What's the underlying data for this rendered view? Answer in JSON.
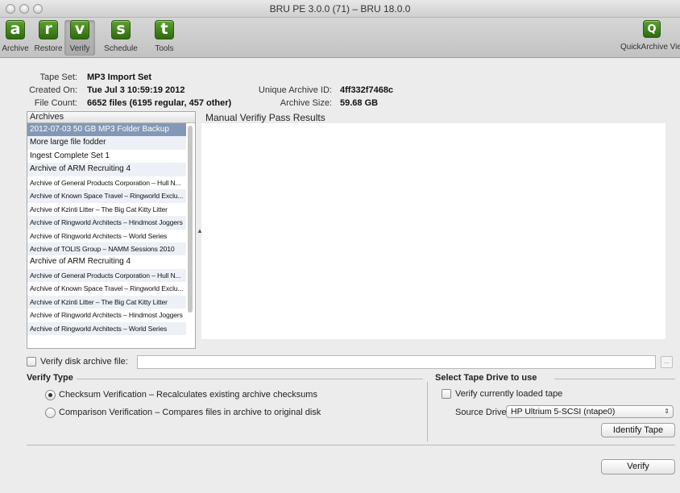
{
  "window": {
    "title": "BRU PE 3.0.0 (71) – BRU 18.0.0"
  },
  "toolbar": {
    "buttons": [
      {
        "glyph": "a",
        "label": "Archive",
        "icon": "archive-icon"
      },
      {
        "glyph": "r",
        "label": "Restore",
        "icon": "restore-icon"
      },
      {
        "glyph": "v",
        "label": "Verify",
        "icon": "verify-icon",
        "selected": true
      },
      {
        "glyph": "s",
        "label": "Schedule",
        "icon": "schedule-icon"
      },
      {
        "glyph": "t",
        "label": "Tools",
        "icon": "tools-icon"
      }
    ],
    "quickview": {
      "glyph": "Q",
      "label": "QuickArchive View",
      "icon": "quickarchive-view-icon"
    }
  },
  "info": {
    "tape_set_label": "Tape Set:",
    "tape_set": "MP3 Import Set",
    "created_on_label": "Created On:",
    "created_on": "Tue Jul  3 10:59:19 2012",
    "file_count_label": "File Count:",
    "file_count": "6652 files (6195 regular, 457 other)",
    "unique_id_label": "Unique Archive ID:",
    "unique_id": "4ff332f7468c",
    "archive_size_label": "Archive Size:",
    "archive_size": "59.68 GB"
  },
  "archives": {
    "header": "Archives",
    "items": [
      "2012-07-03 50 GB MP3 Folder Backup",
      "More large file fodder",
      "Ingest Complete Set 1",
      "Archive of ARM Recruiting 4",
      "Archive of General Products Corporation – Hull N...",
      "Archive of Known Space Travel – Ringworld Exclu...",
      "Archive of Kzinti Litter – The Big Cat Kitty Litter",
      "Archive of Ringworld Architects – Hindmost Joggers",
      "Archive of Ringworld Architects – World Series",
      "Archive of TOLIS Group – NAMM Sessions 2010",
      "Archive of ARM Recruiting 4",
      "Archive of General Products Corporation – Hull N...",
      "Archive of Known Space Travel – Ringworld Exclu...",
      "Archive of Kzinti Litter – The Big Cat Kitty Litter",
      "Archive of Ringworld Architects – Hindmost Joggers",
      "Archive of Ringworld Architects – World Series"
    ],
    "selected_index": 0
  },
  "results": {
    "title": "Manual Verifiy Pass Results"
  },
  "verify_disk": {
    "label": "Verify disk archive file:",
    "value": "",
    "browse_label": "..."
  },
  "verify_type": {
    "title": "Verify Type",
    "checksum_label": "Checksum Verification – Recalculates existing archive checksums",
    "comparison_label": "Comparison Verification – Compares files in archive to original disk",
    "selected": "checksum"
  },
  "tape_drive": {
    "title": "Select Tape Drive to use",
    "loaded_label": "Verify currently loaded tape",
    "source_label": "Source Drive:",
    "source_value": "HP Ultrium 5-SCSI (ntape0)",
    "identify_label": "Identify Tape"
  },
  "actions": {
    "verify_label": "Verify"
  }
}
